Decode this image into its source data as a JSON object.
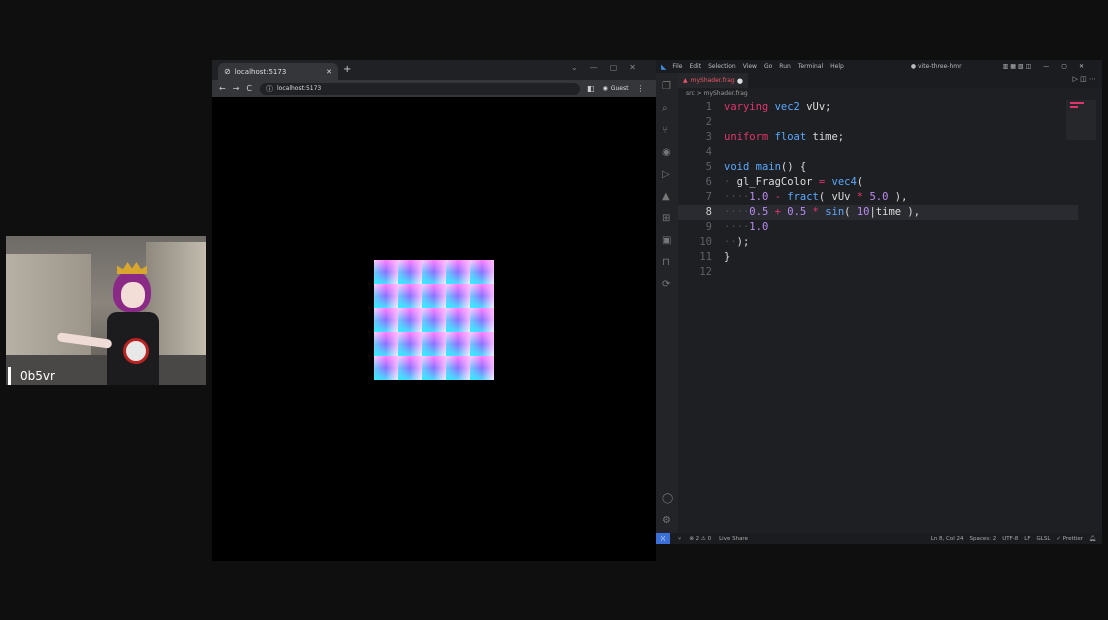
{
  "webcam": {
    "label": "0b5vr"
  },
  "browser": {
    "tab_title": "localhost:5173",
    "url": "localhost:5173",
    "profile": "Guest",
    "grid_cells": 25
  },
  "vscode": {
    "menu": [
      "File",
      "Edit",
      "Selection",
      "View",
      "Go",
      "Run",
      "Terminal",
      "Help"
    ],
    "project": "● vite-three-hmr",
    "tab_file": "myShader.frag",
    "breadcrumb": "src > myShader.frag",
    "status": {
      "problems": "⊗ 2 ⚠ 0",
      "live_share": "Live Share",
      "position": "Ln 8, Col 24",
      "spaces": "Spaces: 2",
      "encoding": "UTF-8",
      "eol": "LF",
      "language": "GLSL",
      "prettier": "✓ Prettier"
    },
    "line_numbers": [
      "1",
      "2",
      "3",
      "4",
      "5",
      "6",
      "7",
      "8",
      "9",
      "10",
      "11",
      "12"
    ]
  },
  "colors": {
    "keyword": "#e0356a",
    "type": "#5aa9ff",
    "number": "#b98cf2",
    "accent": "#3a6fd8"
  }
}
